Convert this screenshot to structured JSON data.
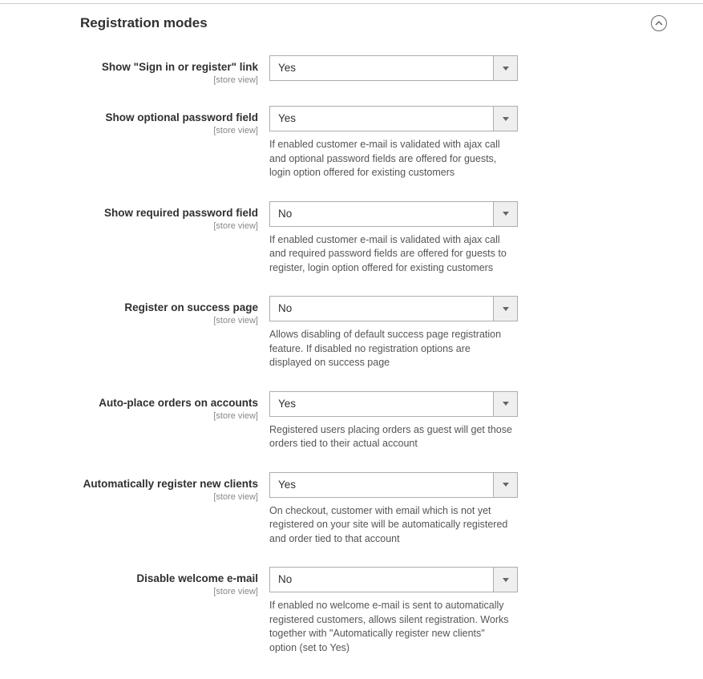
{
  "section": {
    "title": "Registration modes"
  },
  "scope_label": "[store view]",
  "fields": {
    "sign_in_link": {
      "label": "Show \"Sign in or register\" link",
      "value": "Yes",
      "note": ""
    },
    "optional_pw": {
      "label": "Show optional password field",
      "value": "Yes",
      "note": "If enabled customer e-mail is validated with ajax call and optional password fields are offered for guests, login option offered for existing customers"
    },
    "required_pw": {
      "label": "Show required password field",
      "value": "No",
      "note": "If enabled customer e-mail is validated with ajax call and required password fields are offered for guests to register, login option offered for existing customers"
    },
    "register_success": {
      "label": "Register on success page",
      "value": "No",
      "note": "Allows disabling of default success page registration feature. If disabled no registration options are displayed on success page"
    },
    "auto_place": {
      "label": "Auto-place orders on accounts",
      "value": "Yes",
      "note": "Registered users placing orders as guest will get those orders tied to their actual account"
    },
    "auto_register": {
      "label": "Automatically register new clients",
      "value": "Yes",
      "note": "On checkout, customer with email which is not yet registered on your site will be automatically registered and order tied to that account"
    },
    "disable_welcome": {
      "label": "Disable welcome e-mail",
      "value": "No",
      "note": "If enabled no welcome e-mail is sent to automatically registered customers, allows silent registration. Works together with \"Automatically register new clients\" option (set to Yes)"
    }
  }
}
